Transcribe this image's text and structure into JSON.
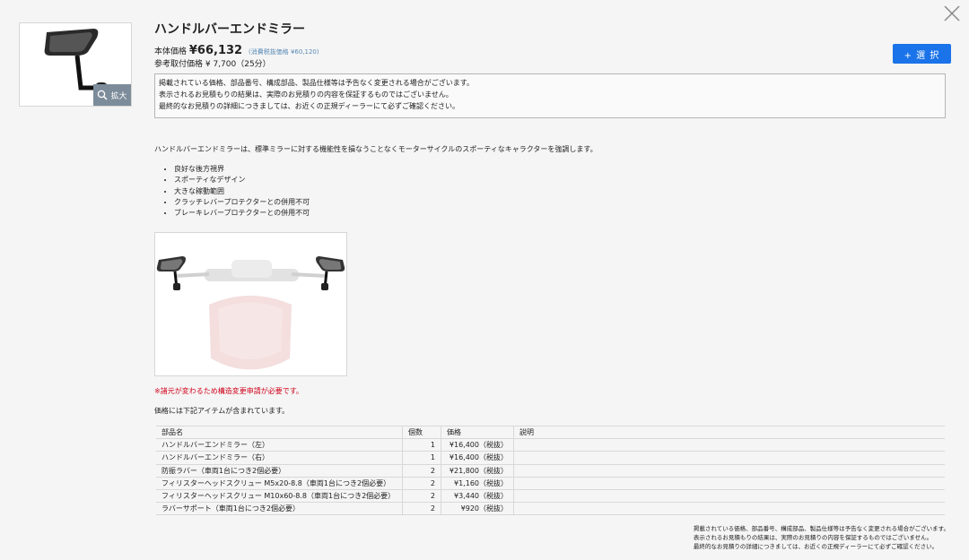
{
  "product": {
    "title": "ハンドルバーエンドミラー",
    "price_label": "本体価格",
    "price_value": "¥66,132",
    "tax_note": "(消費税抜価格 ¥60,120)",
    "install_line": "参考取付価格 ¥ 7,700（25分）",
    "zoom_label": "拡大",
    "select_label": "+ 選 択"
  },
  "notice": {
    "lines": [
      "掲載されている価格、部品番号、構成部品、製品仕様等は予告なく変更される場合がございます。",
      "表示されるお見積もりの結果は、実際のお見積りの内容を保証するものではございません。",
      "最終的なお見積りの詳細につきましては、お近くの正規ディーラーにて必ずご確認ください。"
    ]
  },
  "description": "ハンドルバーエンドミラーは、標準ミラーに対する機能性を損なうことなくモーターサイクルのスポーティなキャラクターを強調します。",
  "features": [
    "良好な後方視界",
    "スポーティなデザイン",
    "大きな稼動範囲",
    "クラッチレバープロテクターとの併用不可",
    "ブレーキレバープロテクターとの併用不可"
  ],
  "warning": "※諸元が変わるため構造変更申請が必要です。",
  "included_text": "価格には下記アイテムが含まれています。",
  "parts_table": {
    "headers": {
      "name": "部品名",
      "qty": "個数",
      "price": "価格",
      "desc": "説明"
    },
    "rows": [
      {
        "name": "ハンドルバーエンドミラー（左）",
        "qty": "1",
        "price": "¥16,400（税抜）",
        "desc": ""
      },
      {
        "name": "ハンドルバーエンドミラー（右）",
        "qty": "1",
        "price": "¥16,400（税抜）",
        "desc": ""
      },
      {
        "name": "防振ラバー（車両1台につき2個必要）",
        "qty": "2",
        "price": "¥21,800（税抜）",
        "desc": ""
      },
      {
        "name": "フィリスターヘッドスクリュー M5x20-8.8（車両1台につき2個必要）",
        "qty": "2",
        "price": "¥1,160（税抜）",
        "desc": ""
      },
      {
        "name": "フィリスターヘッドスクリュー M10x60-8.8（車両1台につき2個必要）",
        "qty": "2",
        "price": "¥3,440（税抜）",
        "desc": ""
      },
      {
        "name": "ラバーサポート（車両1台につき2個必要）",
        "qty": "2",
        "price": "¥920（税抜）",
        "desc": ""
      }
    ]
  },
  "footnote": {
    "lines": [
      "掲載されている価格、部品番号、構成部品、製品仕様等は予告なく変更される場合がございます。",
      "表示されるお見積もりの結果は、実際のお見積りの内容を保証するものではございません。",
      "最終的なお見積りの詳細につきましては、お近くの正規ディーラーにて必ずご確認ください。"
    ]
  },
  "colors": {
    "accent": "#1a73e8",
    "warning": "#d0021b",
    "tax_note": "#5a8bb7"
  },
  "icons": {
    "close": "close-icon",
    "zoom": "magnifier-icon"
  }
}
